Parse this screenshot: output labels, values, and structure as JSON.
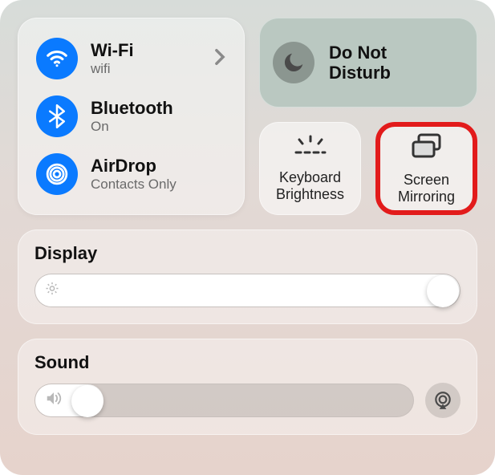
{
  "connectivity": {
    "wifi": {
      "title": "Wi-Fi",
      "subtitle": "wifi"
    },
    "bluetooth": {
      "title": "Bluetooth",
      "subtitle": "On"
    },
    "airdrop": {
      "title": "AirDrop",
      "subtitle": "Contacts Only"
    }
  },
  "dnd": {
    "line1": "Do Not",
    "line2": "Disturb"
  },
  "tiles": {
    "keyboard": {
      "line1": "Keyboard",
      "line2": "Brightness"
    },
    "mirroring": {
      "line1": "Screen",
      "line2": "Mirroring"
    }
  },
  "display": {
    "title": "Display",
    "value_pct": 100
  },
  "sound": {
    "title": "Sound",
    "value_pct": 18
  },
  "highlight": "screen-mirroring-tile"
}
